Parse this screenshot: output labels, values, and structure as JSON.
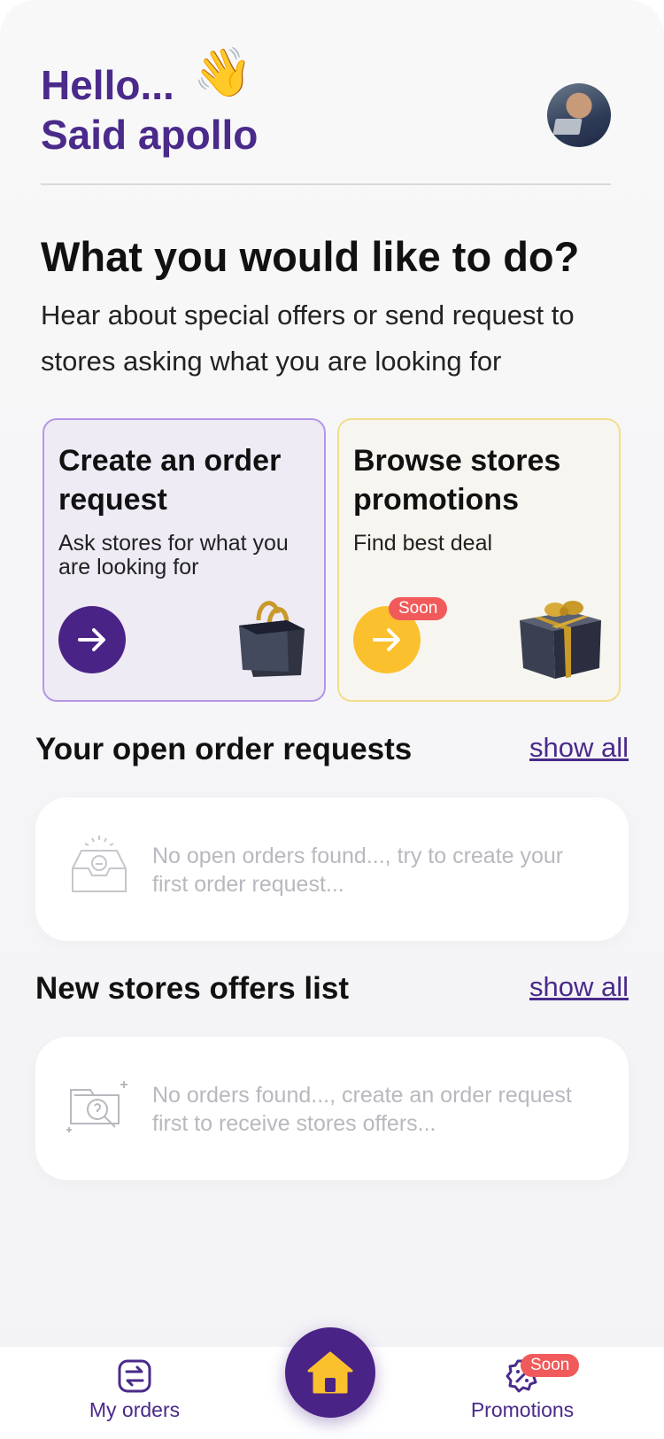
{
  "greeting": {
    "line1": "Hello...",
    "wave_emoji": "👋",
    "name": "Said apollo"
  },
  "main": {
    "question": "What you would like to do?",
    "subtitle": "Hear about special offers or send request to stores asking what you are looking for"
  },
  "cards": {
    "create": {
      "title": "Create an order request",
      "desc": "Ask stores for what you are looking for",
      "icon": "arrow-right-icon",
      "accent": "#4a2386"
    },
    "browse": {
      "title": "Browse stores promotions",
      "desc": "Find best deal",
      "badge": "Soon",
      "icon": "arrow-right-icon",
      "accent": "#fbc02d"
    }
  },
  "open_orders": {
    "title": "Your open order requests",
    "show_all": "show all",
    "empty_text": "No open orders found..., try to create your first order request..."
  },
  "offers": {
    "title": "New stores offers list",
    "show_all": "show all",
    "empty_text": "No orders found..., create an order request first to receive stores offers..."
  },
  "tabbar": {
    "my_orders": "My orders",
    "promotions": "Promotions",
    "promotions_badge": "Soon",
    "home_icon": "home-icon"
  },
  "colors": {
    "primary": "#4a2386",
    "yellow": "#fbc02d",
    "badge": "#f15a5a"
  }
}
